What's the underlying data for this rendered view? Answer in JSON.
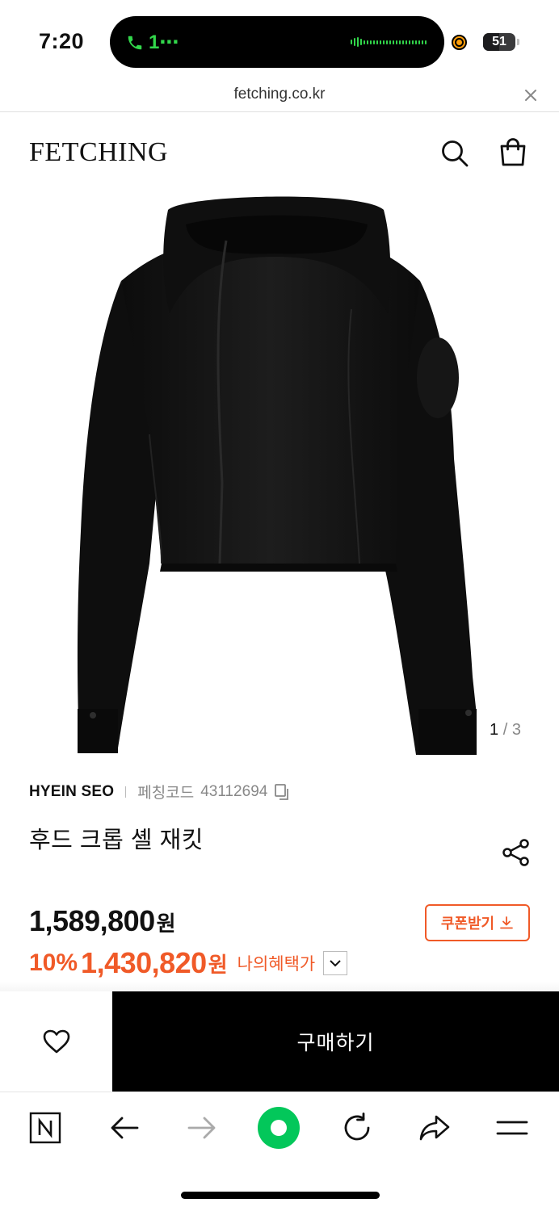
{
  "status_bar": {
    "time": "7:20",
    "call_indicator": "1⋯",
    "battery": "51",
    "battery_level": 0.51
  },
  "browser": {
    "url": "fetching.co.kr"
  },
  "header": {
    "logo": "FETCHING",
    "icons": [
      "search-icon",
      "shopping-bag-icon"
    ]
  },
  "gallery": {
    "current": "1",
    "separator": "/",
    "total": "3"
  },
  "product": {
    "brand": "HYEIN SEO",
    "code_label": "페칭코드",
    "code": "43112694",
    "title": "후드 크롭 셸 재킷",
    "price": "1,589,800",
    "currency": "원",
    "discount_percent": "10%",
    "sale_price": "1,430,820",
    "sale_currency": "원",
    "benefit_label": "나의혜택가",
    "coupon_label": "쿠폰받기"
  },
  "buy_bar": {
    "buy_label": "구매하기"
  },
  "colors": {
    "accent": "#f05a28",
    "buy_bg": "#000000",
    "green": "#32d74b",
    "naver_green": "#03c75a"
  },
  "nav": {
    "icons": [
      "naver-n-icon",
      "back-arrow-icon",
      "forward-arrow-icon",
      "green-dot-icon",
      "reload-icon",
      "share-arrow-icon",
      "menu-icon"
    ]
  }
}
